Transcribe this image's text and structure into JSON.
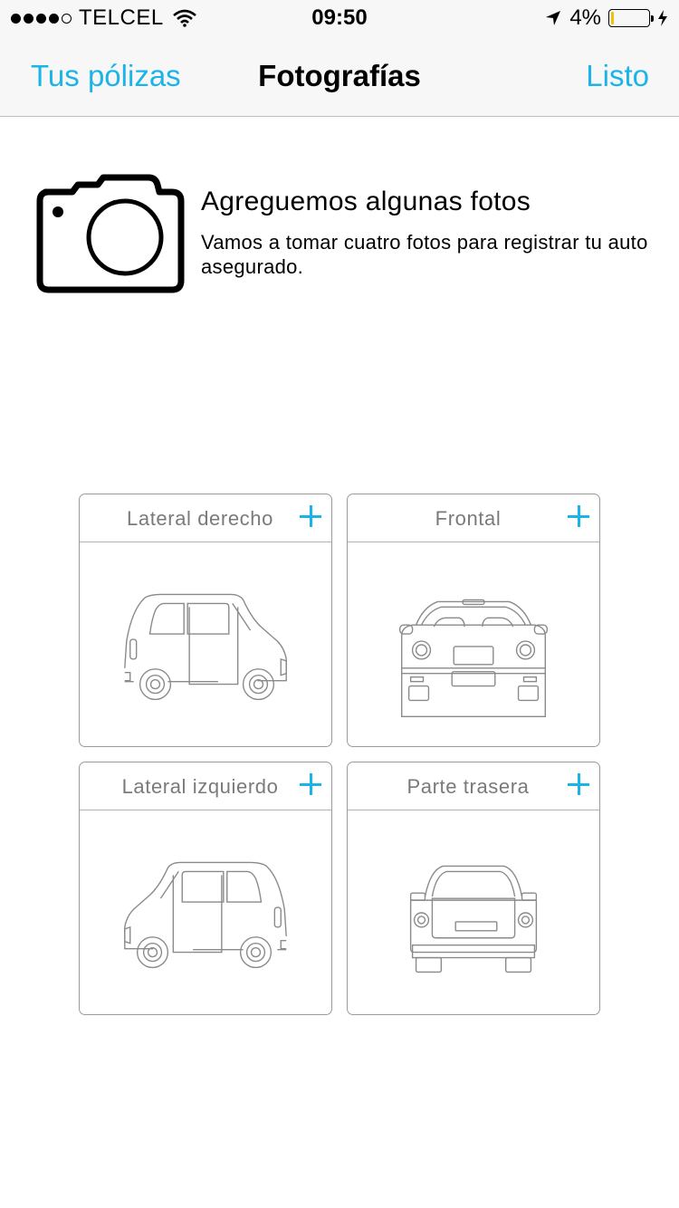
{
  "status_bar": {
    "carrier": "TELCEL",
    "time": "09:50",
    "battery": "4%",
    "battery_level": 0.04,
    "signal_bars_filled": 4,
    "signal_bars_total": 5
  },
  "nav": {
    "back_label": "Tus pólizas",
    "title": "Fotografías",
    "done_label": "Listo"
  },
  "intro": {
    "icon": "camera-icon",
    "title": "Agreguemos algunas fotos",
    "text": "Vamos a tomar cuatro fotos para registrar tu auto asegurado."
  },
  "photo_slots": [
    {
      "label": "Lateral derecho",
      "icon": "car-right-side-icon"
    },
    {
      "label": "Frontal",
      "icon": "car-front-icon"
    },
    {
      "label": "Lateral izquierdo",
      "icon": "car-left-side-icon"
    },
    {
      "label": "Parte trasera",
      "icon": "car-rear-icon"
    }
  ],
  "colors": {
    "accent": "#1bb4e8",
    "bar_background": "#f7f7f7",
    "card_border": "#9a9a9a",
    "battery_low": "#f2c100"
  }
}
